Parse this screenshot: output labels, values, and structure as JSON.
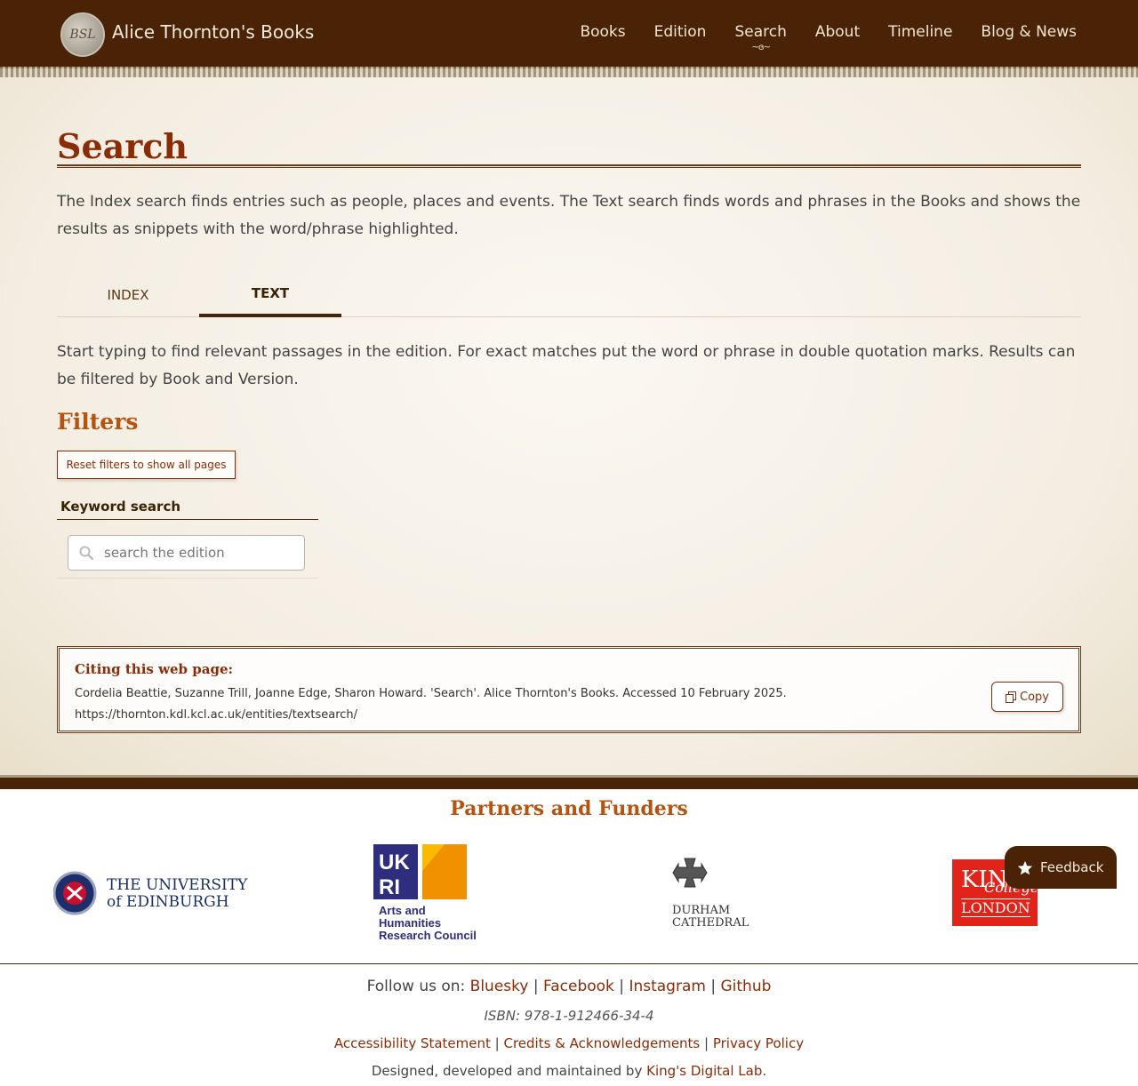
{
  "header": {
    "logo_text": "BSL",
    "site_title": "Alice Thornton's Books",
    "nav": [
      "Books",
      "Edition",
      "Search",
      "About",
      "Timeline",
      "Blog & News"
    ],
    "active_nav": "Search"
  },
  "main": {
    "page_title": "Search",
    "intro": "The Index search finds entries such as people, places and events. The Text search finds words and phrases in the Books and shows the results as snippets with the word/phrase highlighted.",
    "tabs": [
      {
        "label": "INDEX",
        "active": false
      },
      {
        "label": "TEXT",
        "active": true
      }
    ],
    "hint": "Start typing to find relevant passages in the edition. For exact matches put the word or phrase in double quotation marks. Results can be filtered by Book and Version.",
    "filters_title": "Filters",
    "reset_label": "Reset filters to show all pages",
    "keyword_label": "Keyword search",
    "search_placeholder": "search the edition"
  },
  "citation": {
    "title": "Citing this web page:",
    "line1": "Cordelia Beattie, Suzanne Trill, Joanne Edge, Sharon Howard. 'Search'. Alice Thornton's Books. Accessed 10 February 2025.",
    "line2": "https://thornton.kdl.kcl.ac.uk/entities/textsearch/",
    "copy_label": "Copy"
  },
  "partners": {
    "title": "Partners and Funders",
    "edinburgh_line1": "THE UNIVERSITY",
    "edinburgh_line2": "of EDINBURGH",
    "ukri_text": [
      "Arts and",
      "Humanities",
      "Research Council"
    ],
    "durham_text": [
      "DURHAM",
      "CATHEDRAL"
    ],
    "kings_text": [
      "KING'S",
      "College",
      "LONDON"
    ]
  },
  "feedback_label": "Feedback",
  "footer": {
    "follow_prefix": "Follow us on:",
    "social": [
      "Bluesky",
      "Facebook",
      "Instagram",
      "Github"
    ],
    "isbn": "ISBN: 978-1-912466-34-4",
    "links": [
      "Accessibility Statement",
      "Credits & Acknowledgements",
      "Privacy Policy"
    ],
    "made_by_prefix": "Designed, developed and maintained by",
    "made_by_link": "King's Digital Lab",
    "made_by_suffix": "."
  },
  "colors": {
    "header_bg": "#4a2205",
    "accent": "#8a2c06",
    "heading_orange": "#b5530f"
  }
}
